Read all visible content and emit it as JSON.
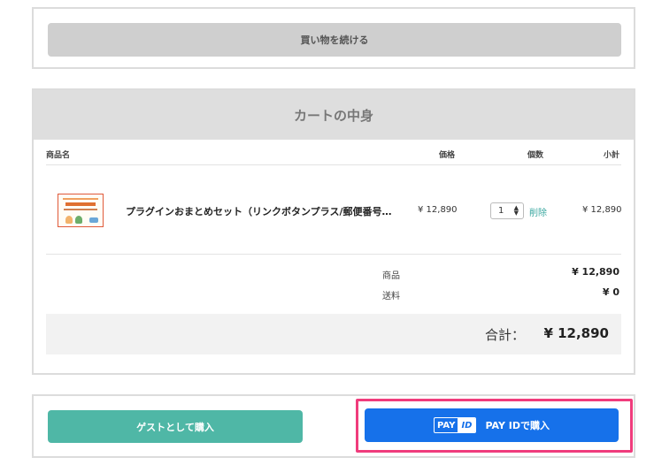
{
  "actions": {
    "continue_shopping": "買い物を続ける",
    "guest_purchase": "ゲストとして購入",
    "payid_purchase": "PAY IDで購入",
    "payid_logo_left": "PAY",
    "payid_logo_right": "ID"
  },
  "cart": {
    "title": "カートの中身",
    "columns": {
      "product": "商品名",
      "price": "価格",
      "quantity": "個数",
      "subtotal": "小計"
    },
    "items": [
      {
        "name": "プラグインおまとめセット（リンクボタンプラス/郵便番号…",
        "price": "¥ 12,890",
        "quantity": "1",
        "delete_label": "削除",
        "subtotal": "¥ 12,890"
      }
    ],
    "summary": {
      "products_label": "商品",
      "products_value": "¥ 12,890",
      "shipping_label": "送料",
      "shipping_value": "¥ 0"
    },
    "total_label": "合計：",
    "total_value": "¥ 12,890"
  },
  "colors": {
    "accent_green": "#4fb7a6",
    "accent_blue": "#1671ea",
    "highlight_pink": "#f03c7c",
    "link_teal": "#3aa7a0"
  }
}
